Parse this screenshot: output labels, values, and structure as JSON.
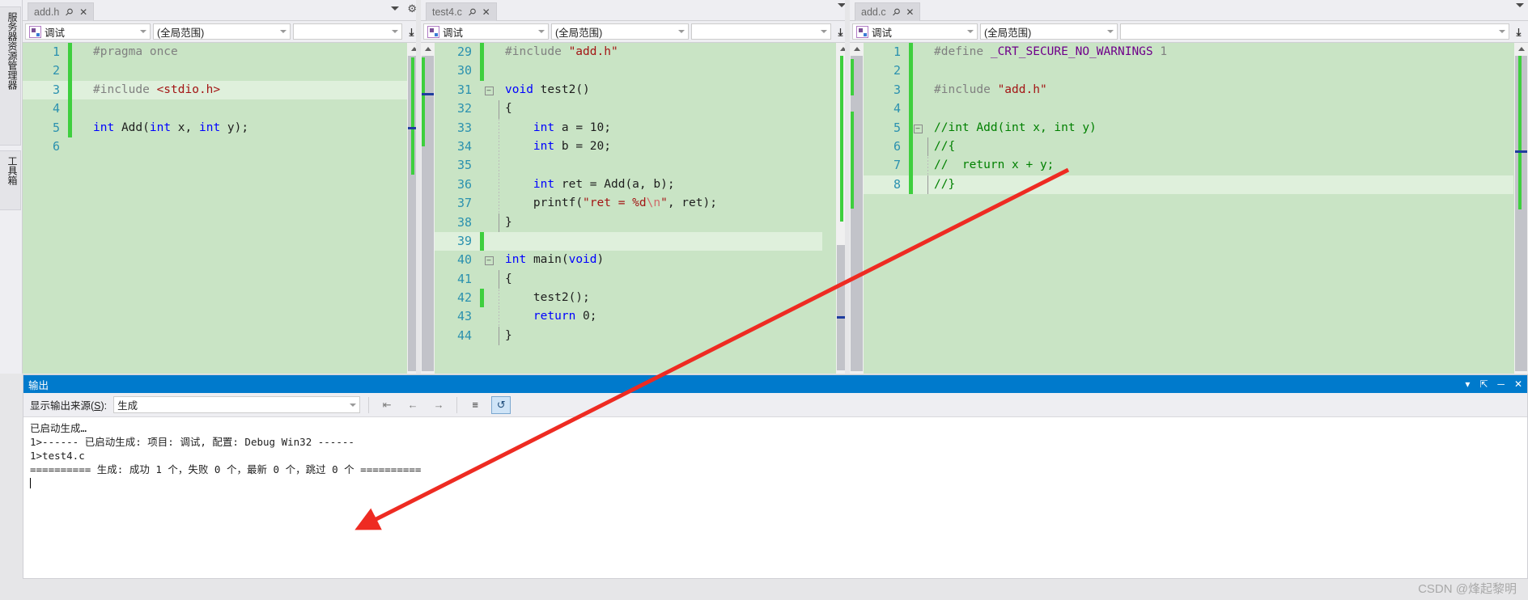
{
  "rail": {
    "items": [
      {
        "label": "服务器资源管理器"
      },
      {
        "label": "工具箱"
      }
    ]
  },
  "panes": [
    {
      "tab": {
        "name": "add.h",
        "pin": "⚲",
        "close": "✕"
      },
      "navbar": {
        "config": "调试",
        "scope": "(全局范围)",
        "member": ""
      },
      "lines": [
        {
          "num": "1",
          "changed": true,
          "fold": "",
          "guide": "",
          "html": "<span class=\"pp\">#pragma once</span>",
          "highlight": false
        },
        {
          "num": "2",
          "changed": true,
          "fold": "",
          "guide": "",
          "html": "",
          "highlight": false
        },
        {
          "num": "3",
          "changed": true,
          "fold": "",
          "guide": "",
          "html": "<span class=\"pp\">#include </span><span class=\"str\">&lt;stdio.h&gt;</span>",
          "highlight": true
        },
        {
          "num": "4",
          "changed": true,
          "fold": "",
          "guide": "",
          "html": "",
          "highlight": false
        },
        {
          "num": "5",
          "changed": true,
          "fold": "",
          "guide": "",
          "html": "<span class=\"k\">int</span> <span class=\"pl\">Add</span>(<span class=\"k\">int</span> x, <span class=\"k\">int</span> y);",
          "highlight": false
        },
        {
          "num": "6",
          "changed": false,
          "fold": "",
          "guide": "",
          "html": "",
          "highlight": false
        }
      ]
    },
    {
      "tab": {
        "name": "test4.c",
        "pin": "⚲",
        "close": "✕"
      },
      "navbar": {
        "config": "调试",
        "scope": "(全局范围)",
        "member": ""
      },
      "lines": [
        {
          "num": "29",
          "changed": true,
          "fold": "",
          "guide": "",
          "html": "<span class=\"pp\">#include </span><span class=\"str\">\"add.h\"</span>",
          "highlight": false
        },
        {
          "num": "30",
          "changed": true,
          "fold": "",
          "guide": "",
          "html": "",
          "highlight": false
        },
        {
          "num": "31",
          "changed": false,
          "fold": "-",
          "guide": "",
          "html": "<span class=\"k\">void</span> <span class=\"pl\">test2</span>()",
          "highlight": false
        },
        {
          "num": "32",
          "changed": false,
          "fold": "",
          "guide": "bar",
          "html": "{",
          "highlight": false
        },
        {
          "num": "33",
          "changed": false,
          "fold": "",
          "guide": "dot",
          "html": "    <span class=\"k\">int</span> a = <span class=\"num\">10</span>;",
          "highlight": false
        },
        {
          "num": "34",
          "changed": false,
          "fold": "",
          "guide": "dot",
          "html": "    <span class=\"k\">int</span> b = <span class=\"num\">20</span>;",
          "highlight": false
        },
        {
          "num": "35",
          "changed": false,
          "fold": "",
          "guide": "dot",
          "html": "",
          "highlight": false
        },
        {
          "num": "36",
          "changed": false,
          "fold": "",
          "guide": "dot",
          "html": "    <span class=\"k\">int</span> ret = <span class=\"pl\">Add</span>(a, b);",
          "highlight": false
        },
        {
          "num": "37",
          "changed": false,
          "fold": "",
          "guide": "dot",
          "html": "    <span class=\"pl\">printf</span>(<span class=\"str\">\"ret = %d</span><span class=\"esc\">\\n</span><span class=\"str\">\"</span>, ret);",
          "highlight": false
        },
        {
          "num": "38",
          "changed": false,
          "fold": "",
          "guide": "bar",
          "html": "}",
          "highlight": false
        },
        {
          "num": "39",
          "changed": true,
          "fold": "",
          "guide": "",
          "html": "",
          "highlight": true
        },
        {
          "num": "40",
          "changed": false,
          "fold": "-",
          "guide": "",
          "html": "<span class=\"k\">int</span> <span class=\"pl\">main</span>(<span class=\"k\">void</span>)",
          "highlight": false
        },
        {
          "num": "41",
          "changed": false,
          "fold": "",
          "guide": "bar",
          "html": "{",
          "highlight": false
        },
        {
          "num": "42",
          "changed": true,
          "fold": "",
          "guide": "dot",
          "html": "    <span class=\"pl\">test2</span>();",
          "highlight": false
        },
        {
          "num": "43",
          "changed": false,
          "fold": "",
          "guide": "dot",
          "html": "    <span class=\"k\">return</span> <span class=\"num\">0</span>;",
          "highlight": false
        },
        {
          "num": "44",
          "changed": false,
          "fold": "",
          "guide": "bar",
          "html": "}",
          "highlight": false
        }
      ]
    },
    {
      "tab": {
        "name": "add.c",
        "pin": "⚲",
        "close": "✕"
      },
      "navbar": {
        "config": "调试",
        "scope": "(全局范围)",
        "member": ""
      },
      "lines": [
        {
          "num": "1",
          "changed": true,
          "fold": "",
          "guide": "",
          "html": "<span class=\"pp\">#define </span><span class=\"mac\">_CRT_SECURE_NO_WARNINGS</span> <span class=\"pp\">1</span>",
          "highlight": false
        },
        {
          "num": "2",
          "changed": true,
          "fold": "",
          "guide": "",
          "html": "",
          "highlight": false
        },
        {
          "num": "3",
          "changed": true,
          "fold": "",
          "guide": "",
          "html": "<span class=\"pp\">#include </span><span class=\"str\">\"add.h\"</span>",
          "highlight": false
        },
        {
          "num": "4",
          "changed": true,
          "fold": "",
          "guide": "",
          "html": "",
          "highlight": false
        },
        {
          "num": "5",
          "changed": true,
          "fold": "-",
          "guide": "",
          "html": "<span class=\"cmt\">//int Add(int x, int y)</span>",
          "highlight": false
        },
        {
          "num": "6",
          "changed": true,
          "fold": "",
          "guide": "bar",
          "html": "<span class=\"cmt\">//{</span>",
          "highlight": false
        },
        {
          "num": "7",
          "changed": true,
          "fold": "",
          "guide": "dot",
          "html": "<span class=\"cmt\">//  return x + y;</span>",
          "highlight": false
        },
        {
          "num": "8",
          "changed": true,
          "fold": "",
          "guide": "bar",
          "html": "<span class=\"cmt\">//}</span>",
          "highlight": true
        }
      ]
    }
  ],
  "output": {
    "title": "输出",
    "title_buttons": {
      "dropdown": "▾",
      "dock": "⇱",
      "minimize": "─",
      "close": "✕"
    },
    "source_label_pre": "显示输出来源(",
    "source_label_key": "S",
    "source_label_post": "):",
    "source_value": "生成",
    "toolbar_icons": [
      "clear-all-icon",
      "back-arrow-icon",
      "forward-arrow-icon",
      "list-icon",
      "wrap-text-icon"
    ],
    "body_lines": [
      "已启动生成…",
      "1>------ 已启动生成: 项目: 调试, 配置: Debug Win32 ------",
      "1>test4.c",
      "========== 生成: 成功 1 个，失败 0 个，最新 0 个，跳过 0 个 =========="
    ]
  },
  "watermark": "CSDN @烽起黎明",
  "colors": {
    "code_background": "#c9e4c5",
    "panel_chrome": "#eeeef2",
    "output_title_bar": "#007acc",
    "change_marker_green": "#3ecf3e",
    "annotation_arrow": "#ee2b22"
  }
}
